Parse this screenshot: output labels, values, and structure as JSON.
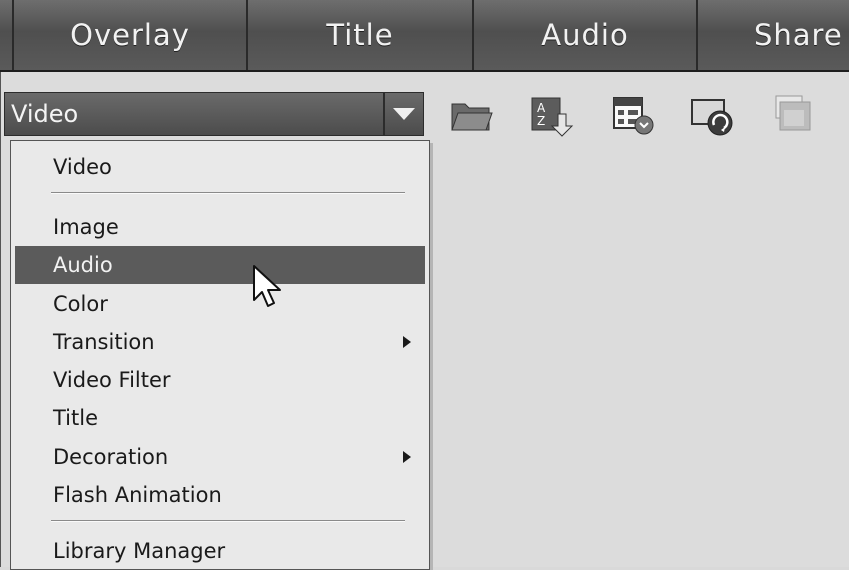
{
  "tabs": [
    {
      "label": "Overlay"
    },
    {
      "label": "Title"
    },
    {
      "label": "Audio"
    },
    {
      "label": "Share"
    }
  ],
  "type_select": {
    "value": "Video"
  },
  "toolbar": {
    "icons": [
      "folder-open-icon",
      "sort-az-icon",
      "view-options-icon",
      "capture-refresh-icon",
      "library-overlay-icon"
    ]
  },
  "menu": {
    "items": [
      {
        "label": "Video"
      },
      {
        "label": "Image"
      },
      {
        "label": "Audio",
        "selected": true
      },
      {
        "label": "Color"
      },
      {
        "label": "Transition",
        "submenu": true
      },
      {
        "label": "Video Filter"
      },
      {
        "label": "Title"
      },
      {
        "label": "Decoration",
        "submenu": true
      },
      {
        "label": "Flash Animation"
      },
      {
        "label": "Library Manager"
      }
    ]
  },
  "colors": {
    "selected_bg": "#5b5b5b",
    "tab_bg": "#5a5a5a"
  }
}
